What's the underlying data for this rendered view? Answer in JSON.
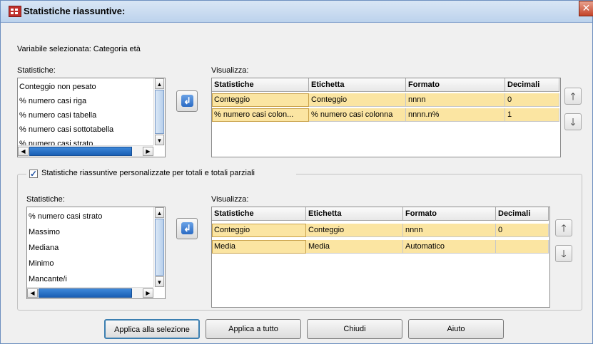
{
  "window": {
    "title": "Statistiche riassuntive:",
    "close_glyph": "✕"
  },
  "selected_variable": "Variabile selezionata: Categoria età",
  "top": {
    "stats_label": "Statistiche:",
    "stats_items": [
      "Conteggio non pesato",
      "% numero casi riga",
      "% numero casi tabella",
      "% numero casi sottotabella",
      "% numero casi strato"
    ],
    "display_label": "Visualizza:",
    "columns": [
      "Statistiche",
      "Etichetta",
      "Formato",
      "Decimali"
    ],
    "rows": [
      [
        "Conteggio",
        "Conteggio",
        "nnnn",
        "0"
      ],
      [
        "% numero casi colon...",
        "% numero casi colonna",
        "nnnn.n%",
        "1"
      ]
    ]
  },
  "custom_totals": {
    "checkbox_label": "Statistiche riassuntive personalizzate per totali e totali parziali",
    "checked": true,
    "stats_label": "Statistiche:",
    "stats_items": [
      "% numero casi strato",
      "Massimo",
      "Mediana",
      "Minimo",
      "Mancante/i"
    ],
    "display_label": "Visualizza:",
    "columns": [
      "Statistiche",
      "Etichetta",
      "Formato",
      "Decimali"
    ],
    "rows": [
      [
        "Conteggio",
        "Conteggio",
        "nnnn",
        "0"
      ],
      [
        "Media",
        "Media",
        "Automatico",
        ""
      ]
    ]
  },
  "buttons": {
    "apply_selection": "Applica alla selezione",
    "apply_all": "Applica a tutto",
    "close": "Chiudi",
    "help": "Aiuto"
  },
  "icons": {
    "move": "left-arrow-icon",
    "up": "up-arrow-icon",
    "down": "down-arrow-icon",
    "title": "table-icon"
  },
  "colors": {
    "selected_row": "#fbe5a2",
    "title_bar": "#bcd2ec",
    "accent": "#2b6bc4"
  }
}
